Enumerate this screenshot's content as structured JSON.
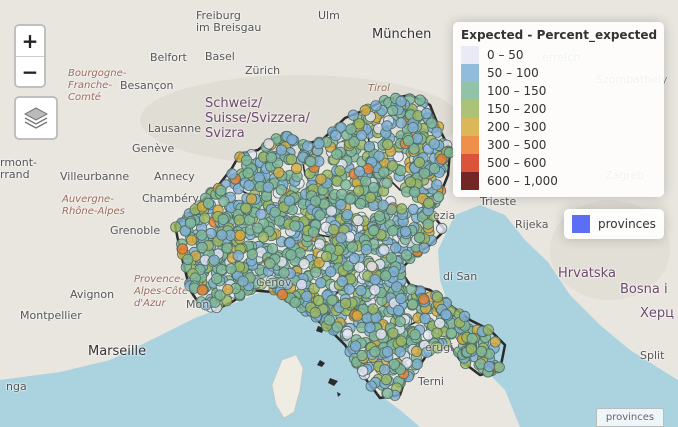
{
  "map": {
    "zoom_in_label": "+",
    "zoom_out_label": "−",
    "places": [
      {
        "name": "Freiburg im Breisgau",
        "cls": "",
        "lines": [
          "Freiburg",
          "im Breisgau"
        ]
      },
      {
        "name": "Ulm",
        "cls": "",
        "lines": [
          "Ulm"
        ]
      },
      {
        "name": "München",
        "cls": "big",
        "lines": [
          "München"
        ]
      },
      {
        "name": "Belfort",
        "cls": "",
        "lines": [
          "Belfort"
        ]
      },
      {
        "name": "Basel",
        "cls": "",
        "lines": [
          "Basel"
        ]
      },
      {
        "name": "Zürich",
        "cls": "",
        "lines": [
          "Zürich"
        ]
      },
      {
        "name": "Bourgogne-Franche-Comté",
        "cls": "region",
        "lines": [
          "Bourgogne-",
          "Franche-",
          "Comté"
        ]
      },
      {
        "name": "Besançon",
        "cls": "",
        "lines": [
          "Besançon"
        ]
      },
      {
        "name": "Schweiz/Suisse/Svizzera/Svizra",
        "cls": "country",
        "lines": [
          "Schweiz/",
          "Suisse/Svizzera/",
          "Svizra"
        ]
      },
      {
        "name": "Tirol",
        "cls": "region",
        "lines": [
          "Tirol"
        ]
      },
      {
        "name": "Lausanne",
        "cls": "",
        "lines": [
          "Lausanne"
        ]
      },
      {
        "name": "Genève",
        "cls": "",
        "lines": [
          "Genève"
        ]
      },
      {
        "name": "Annecy",
        "cls": "",
        "lines": [
          "Annecy"
        ]
      },
      {
        "name": "Villeurbanne",
        "cls": "",
        "lines": [
          "Villeurbanne"
        ]
      },
      {
        "name": "rmont-rrand",
        "cls": "",
        "lines": [
          "rmont-",
          "rrand"
        ]
      },
      {
        "name": "Auvergne-Rhône-Alpes",
        "cls": "region",
        "lines": [
          "Auvergne-",
          "Rhône-Alpes"
        ]
      },
      {
        "name": "Chambéry",
        "cls": "",
        "lines": [
          "Chambéry"
        ]
      },
      {
        "name": "Grenoble",
        "cls": "",
        "lines": [
          "Grenoble"
        ]
      },
      {
        "name": "Avignon",
        "cls": "",
        "lines": [
          "Avignon"
        ]
      },
      {
        "name": "Provence-Alpes-Côte d'Azur",
        "cls": "region",
        "lines": [
          "Provence-",
          "Alpes-Côte",
          "d'Azur"
        ]
      },
      {
        "name": "Montpellier",
        "cls": "",
        "lines": [
          "Montpellier"
        ]
      },
      {
        "name": "Marseille",
        "cls": "big",
        "lines": [
          "Marseille"
        ]
      },
      {
        "name": "Mon",
        "cls": "",
        "lines": [
          "Mon"
        ]
      },
      {
        "name": "Genov",
        "cls": "",
        "lines": [
          "Genov"
        ]
      },
      {
        "name": "Trieste",
        "cls": "",
        "lines": [
          "Trieste"
        ]
      },
      {
        "name": "ezia",
        "cls": "",
        "lines": [
          "ezia"
        ]
      },
      {
        "name": "Zagreb",
        "cls": "muted",
        "lines": [
          "Zagreb"
        ]
      },
      {
        "name": "Szombathely",
        "cls": "muted",
        "lines": [
          "Szombathely"
        ]
      },
      {
        "name": "erreich",
        "cls": "muted",
        "lines": [
          "erreich"
        ]
      },
      {
        "name": "Rijeka",
        "cls": "",
        "lines": [
          "Rijeka"
        ]
      },
      {
        "name": "Hrvatska",
        "cls": "country",
        "lines": [
          "Hrvatska"
        ]
      },
      {
        "name": "Bosna i",
        "cls": "country",
        "lines": [
          "Bosna i"
        ]
      },
      {
        "name": "Херц",
        "cls": "country",
        "lines": [
          "Херц"
        ]
      },
      {
        "name": "di San",
        "cls": "",
        "lines": [
          "di San"
        ]
      },
      {
        "name": "erugi",
        "cls": "",
        "lines": [
          "erugi"
        ]
      },
      {
        "name": "Terni",
        "cls": "",
        "lines": [
          "Terni"
        ]
      },
      {
        "name": "nga",
        "cls": "",
        "lines": [
          "nga"
        ]
      },
      {
        "name": "Split",
        "cls": "",
        "lines": [
          "Split"
        ]
      }
    ]
  },
  "legend": {
    "title": "Expected - Percent_expected",
    "rows": [
      {
        "label": "0 – 50",
        "color": "#e6e6f5"
      },
      {
        "label": "50 – 100",
        "color": "#7fb0d6"
      },
      {
        "label": "100 – 150",
        "color": "#7fb89a"
      },
      {
        "label": "150 – 200",
        "color": "#9cb85f"
      },
      {
        "label": "200 – 300",
        "color": "#d6aa3c"
      },
      {
        "label": "300 – 500",
        "color": "#ec7d2a"
      },
      {
        "label": "500 – 600",
        "color": "#d53616"
      },
      {
        "label": "600 – 1,000",
        "color": "#5a0000"
      }
    ]
  },
  "overlay_legend": {
    "label": "provinces",
    "color": "#5b6ef5"
  },
  "attribution": "provinces",
  "points": {
    "count": 1500,
    "weights": [
      10,
      30,
      33,
      18,
      7,
      2,
      0,
      0
    ]
  }
}
